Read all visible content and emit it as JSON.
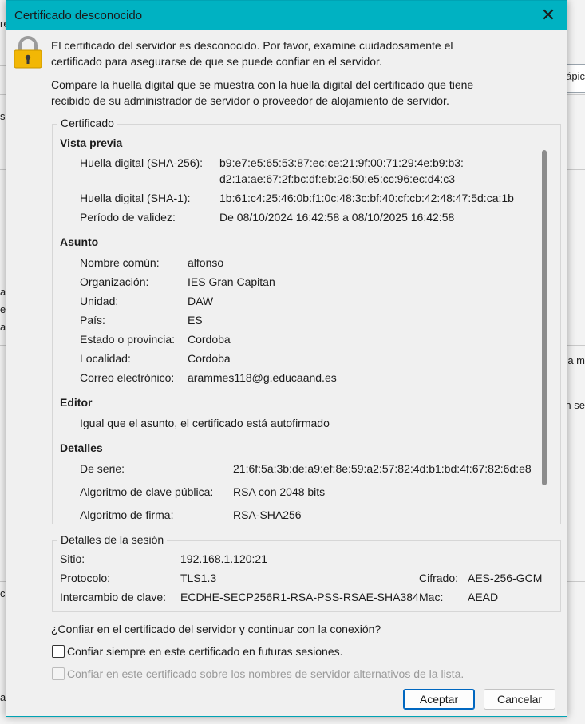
{
  "background": {
    "fragments": [
      "re",
      "ápic",
      "s",
      "a",
      "e",
      "a",
      "a m",
      "n se",
      "c",
      "a"
    ]
  },
  "dialog": {
    "title": "Certificado desconocido",
    "close_glyph": "✕",
    "intro_line1": "El certificado del servidor es desconocido. Por favor, examine cuidadosamente el",
    "intro_line2": "certificado para asegurarse de que se puede confiar en el servidor.",
    "compare_line1": "Compare la huella digital que se muestra con la huella digital del certificado que tiene",
    "compare_line2": "recibido de su administrador de servidor o proveedor de alojamiento de servidor."
  },
  "certificate": {
    "group_label": "Certificado",
    "preview": {
      "heading": "Vista previa",
      "sha256_label": "Huella digital (SHA-256):",
      "sha256_line1": "b9:e7:e5:65:53:87:ec:ce:21:9f:00:71:29:4e:b9:b3:",
      "sha256_line2": "d2:1a:ae:67:2f:bc:df:eb:2c:50:e5:cc:96:ec:d4:c3",
      "sha1_label": "Huella digital (SHA-1):",
      "sha1_value": "1b:61:c4:25:46:0b:f1:0c:48:3c:bf:40:cf:cb:42:48:47:5d:ca:1b",
      "validity_label": "Período de validez:",
      "validity_value": "De 08/10/2024 16:42:58 a 08/10/2025 16:42:58"
    },
    "subject": {
      "heading": "Asunto",
      "rows": [
        {
          "label": "Nombre común:",
          "value": "alfonso"
        },
        {
          "label": "Organización:",
          "value": "IES Gran Capitan"
        },
        {
          "label": "Unidad:",
          "value": "DAW"
        },
        {
          "label": "País:",
          "value": "ES"
        },
        {
          "label": "Estado o provincia:",
          "value": "Cordoba"
        },
        {
          "label": "Localidad:",
          "value": "Cordoba"
        },
        {
          "label": "Correo electrónico:",
          "value": "arammes118@g.educaand.es"
        }
      ]
    },
    "issuer": {
      "heading": "Editor",
      "text": "Igual que el asunto, el certificado está autofirmado"
    },
    "details": {
      "heading": "Detalles",
      "serial_label": "De serie:",
      "serial_value": "21:6f:5a:3b:de:a9:ef:8e:59:a2:57:82:4d:b1:bd:4f:67:82:6d:e8",
      "pubkey_label": "Algoritmo de clave pública:",
      "pubkey_value": "RSA con 2048 bits",
      "sigalg_label": "Algoritmo de firma:",
      "sigalg_value": "RSA-SHA256"
    }
  },
  "session": {
    "group_label": "Detalles de la sesión",
    "site_label": "Sitio:",
    "site_value": "192.168.1.120:21",
    "protocol_label": "Protocolo:",
    "protocol_value": "TLS1.3",
    "cipher_label": "Cifrado:",
    "cipher_value": "AES-256-GCM",
    "kex_label": "Intercambio de clave:",
    "kex_value": "ECDHE-SECP256R1-RSA-PSS-RSAE-SHA384",
    "mac_label": "Mac:",
    "mac_value": "AEAD"
  },
  "trust": {
    "question": "¿Confiar en el certificado del servidor y continuar con la conexión?",
    "always_label": "Confiar siempre en este certificado en futuras sesiones.",
    "always_checked": false,
    "alt_names_label": "Confiar en este certificado sobre los nombres de servidor alternativos de la lista.",
    "alt_names_enabled": false
  },
  "buttons": {
    "accept": "Aceptar",
    "cancel": "Cancelar"
  },
  "colors": {
    "titlebar": "#00b2c2",
    "lock_body": "#f2b705"
  }
}
